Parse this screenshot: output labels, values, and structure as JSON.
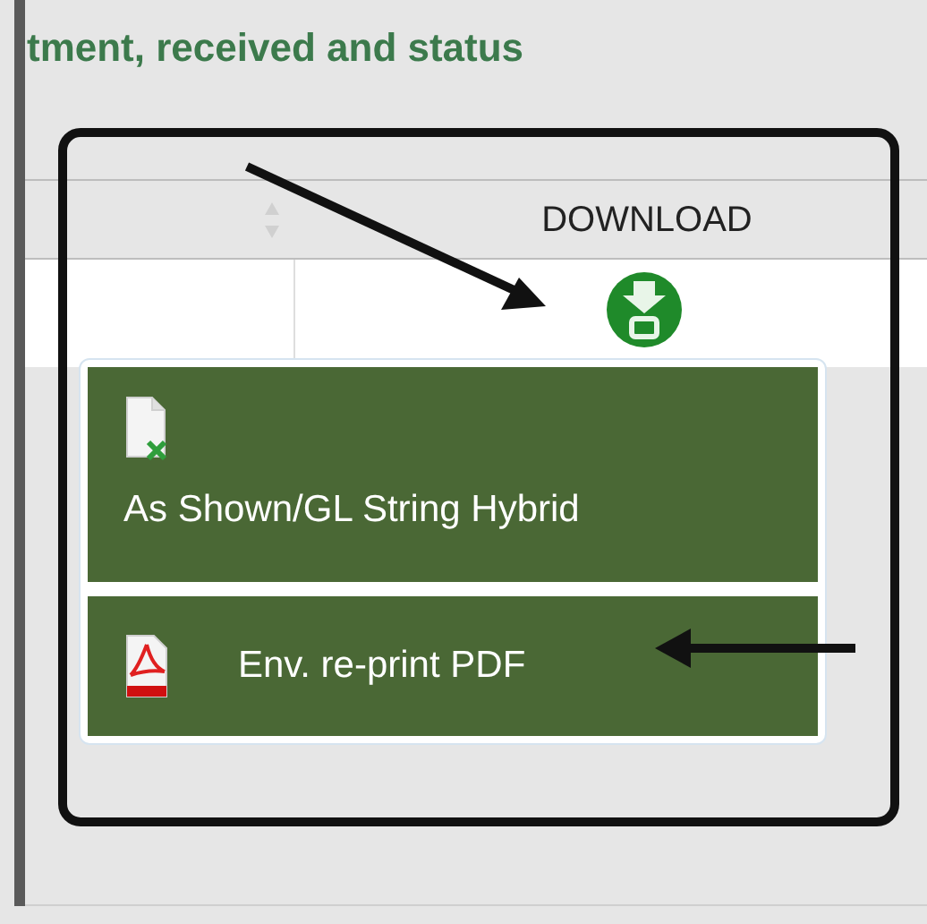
{
  "page_title": "tment, received and status",
  "table": {
    "columns": [
      {
        "kind": "sort"
      },
      {
        "kind": "text",
        "label": "DOWNLOAD"
      }
    ]
  },
  "download_menu": {
    "items": [
      {
        "kind": "spreadsheet",
        "label": "As Shown/GL String Hybrid"
      },
      {
        "kind": "pdf",
        "label": "Env. re-print PDF"
      }
    ]
  }
}
